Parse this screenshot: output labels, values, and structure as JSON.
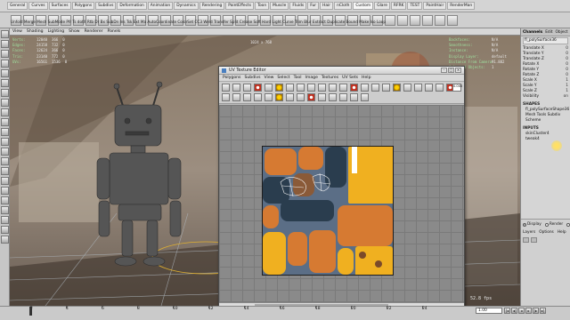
{
  "shelf": {
    "tabs": [
      "General",
      "Curves",
      "Surfaces",
      "Polygons",
      "Subdivs",
      "Deformation",
      "Animation",
      "Dynamics",
      "Rendering",
      "PaintEffects",
      "Toon",
      "Muscle",
      "Fluids",
      "Fur",
      "Hair",
      "nCloth",
      "Custom",
      "Glare",
      "RFRK",
      "TEST",
      "PaintHair",
      "RenderMan"
    ],
    "active_tab": 16,
    "labels_text": "Unfold Merge Mesh SubMode Pfr Ts dotX Rtb Dr Bx SubDn Ins Tsk Ext Ma AutoCoordinate ColorSet CC3 Weld Transfer Split Crease Soft Hard Light Curve Trim Blur Extract Duplicate Bound Make Iso Loop"
  },
  "viewport": {
    "menu": [
      "View",
      "Shading",
      "Lighting",
      "Show",
      "Renderer",
      "Panels"
    ],
    "hud_left": [
      {
        "label": "Verts:",
        "a": "12040",
        "b": "366",
        "c": "0"
      },
      {
        "label": "Edges:",
        "a": "24158",
        "b": "732",
        "c": "0"
      },
      {
        "label": "Faces:",
        "a": "12624",
        "b": "366",
        "c": "0"
      },
      {
        "label": "Tris:",
        "a": "23140",
        "b": "772",
        "c": "0"
      },
      {
        "label": "UVs:",
        "a": "16561",
        "b": "1536",
        "c": "0"
      }
    ],
    "hud_res": "1024 x 768",
    "hud_right": [
      {
        "label": "Backfaces:",
        "value": "N/A"
      },
      {
        "label": "Smoothness:",
        "value": "N/A"
      },
      {
        "label": "Instance:",
        "value": "N/A"
      },
      {
        "label": "Display Layer:",
        "value": "default"
      },
      {
        "label": "Distance From Camera:",
        "value": "91.882"
      },
      {
        "label": "Selected Objects:",
        "value": "1"
      }
    ],
    "fps": "52.8 fps"
  },
  "uv_editor": {
    "title": "UV Texture Editor",
    "menu": [
      "Polygons",
      "Subdivs",
      "View",
      "Select",
      "Tool",
      "Image",
      "Textures",
      "UV Sets",
      "Help"
    ],
    "coord_value": "0.000",
    "colors": {
      "blue": "#5b6e86",
      "orange": "#d67a32",
      "yellow": "#f0b020",
      "navy": "#2a3d4e",
      "brown": "#7a4a2a"
    }
  },
  "channel_box": {
    "tabs": [
      "Channels",
      "Edit",
      "Object",
      "Show"
    ],
    "object_name": "fl_polySurface36",
    "channels": [
      {
        "name": "Translate X",
        "value": "0"
      },
      {
        "name": "Translate Y",
        "value": "0"
      },
      {
        "name": "Translate Z",
        "value": "0"
      },
      {
        "name": "Rotate X",
        "value": "0"
      },
      {
        "name": "Rotate Y",
        "value": "0"
      },
      {
        "name": "Rotate Z",
        "value": "0"
      },
      {
        "name": "Scale X",
        "value": "1"
      },
      {
        "name": "Scale Y",
        "value": "1"
      },
      {
        "name": "Scale Z",
        "value": "1"
      },
      {
        "name": "Visibility",
        "value": "on"
      }
    ],
    "shapes_header": "SHAPES",
    "shapes": [
      "fl_polySurfaceShape36",
      "Mesh Tools Subdiv Scheme"
    ],
    "inputs_header": "INPUTS",
    "inputs": [
      "skinCluster4",
      "tweak4"
    ]
  },
  "layers": {
    "radios": [
      {
        "label": "Display",
        "on": true
      },
      {
        "label": "Render",
        "on": false
      },
      {
        "label": "Anim",
        "on": false
      }
    ],
    "menu": [
      "Layers",
      "Options",
      "Help"
    ]
  },
  "timeline": {
    "ticks": [
      "2",
      "4",
      "6",
      "8",
      "10",
      "12",
      "14",
      "16",
      "18",
      "20",
      "22",
      "24"
    ],
    "range_value": "1.00"
  }
}
